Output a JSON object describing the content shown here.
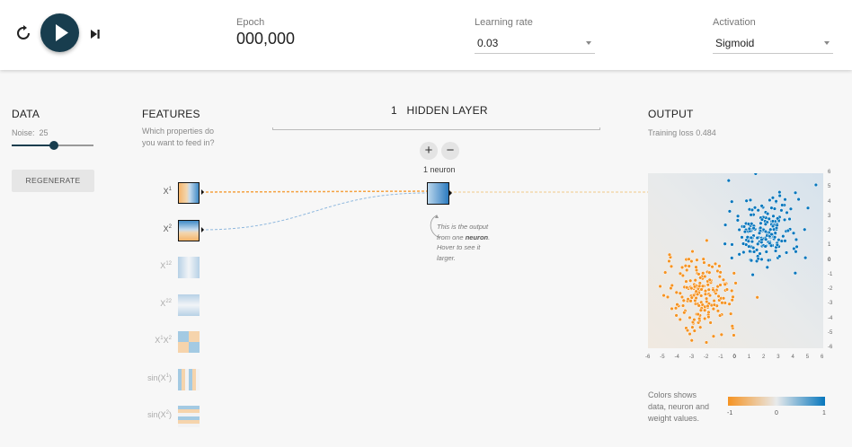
{
  "controls": {
    "reset_icon": "reset-icon",
    "play_icon": "play-icon",
    "step_icon": "step-forward-icon"
  },
  "epoch": {
    "label": "Epoch",
    "value": "000,000"
  },
  "learning_rate": {
    "label": "Learning rate",
    "value": "0.03"
  },
  "activation": {
    "label": "Activation",
    "value": "Sigmoid"
  },
  "data_panel": {
    "title": "DATA",
    "noise_label": "Noise:",
    "noise_value": "25",
    "noise_level": 0.5,
    "regenerate": "REGENERATE"
  },
  "features_panel": {
    "title": "FEATURES",
    "subtitle_line1": "Which properties do",
    "subtitle_line2": "you want to feed in?",
    "features": [
      {
        "base": "X",
        "sup": "1",
        "active": true
      },
      {
        "base": "X",
        "sup": "2",
        "active": true
      },
      {
        "base": "X",
        "sup": "12",
        "active": false
      },
      {
        "base": "X",
        "sup": "22",
        "active": false
      },
      {
        "base": "X",
        "sup": "1",
        "base2": "X",
        "sup2": "2",
        "active": false
      },
      {
        "base": "sin(X",
        "sup": "1",
        "tail": ")",
        "active": false
      },
      {
        "base": "sin(X",
        "sup": "2",
        "tail": ")",
        "active": false
      }
    ]
  },
  "hidden_layer": {
    "count": "1",
    "title": "HIDDEN LAYER",
    "neuron_count": "1 neuron",
    "add_symbol": "+",
    "remove_symbol": "−",
    "note_part1": "This is the output from one",
    "note_bold": "neuron",
    "note_part2": ". Hover to see it larger."
  },
  "output_panel": {
    "title": "OUTPUT",
    "training_loss_label": "Training loss",
    "training_loss_value": "0.484",
    "legend_line1": "Colors shows",
    "legend_line2": "data, neuron and",
    "legend_line3": "weight values.",
    "legend_min": "-1",
    "legend_mid": "0",
    "legend_max": "1"
  },
  "colors": {
    "orange": "#f59322",
    "blue": "#0877bd",
    "dark_button": "#183d4e"
  },
  "chart_data": {
    "type": "scatter",
    "xlim": [
      -6,
      6
    ],
    "ylim": [
      -6,
      6
    ],
    "x_ticks": [
      "-6",
      "-5",
      "-4",
      "-3",
      "-2",
      "-1",
      "0",
      "1",
      "2",
      "3",
      "4",
      "5",
      "6"
    ],
    "y_ticks": [
      "6",
      "5",
      "4",
      "3",
      "2",
      "1",
      "0",
      "-1",
      "-2",
      "-3",
      "-4",
      "-5",
      "-6"
    ],
    "series": [
      {
        "color": "#0877bd",
        "center": [
          2,
          2
        ],
        "spread": 1.2,
        "count": 200
      },
      {
        "color": "#f59322",
        "center": [
          -2.3,
          -2.3
        ],
        "spread": 1.2,
        "count": 200
      }
    ],
    "outlier_points": [
      {
        "x": 5.5,
        "y": 5.2,
        "color": "#0877bd"
      },
      {
        "x": -2.0,
        "y": -5.6,
        "color": "#f59322"
      }
    ]
  }
}
